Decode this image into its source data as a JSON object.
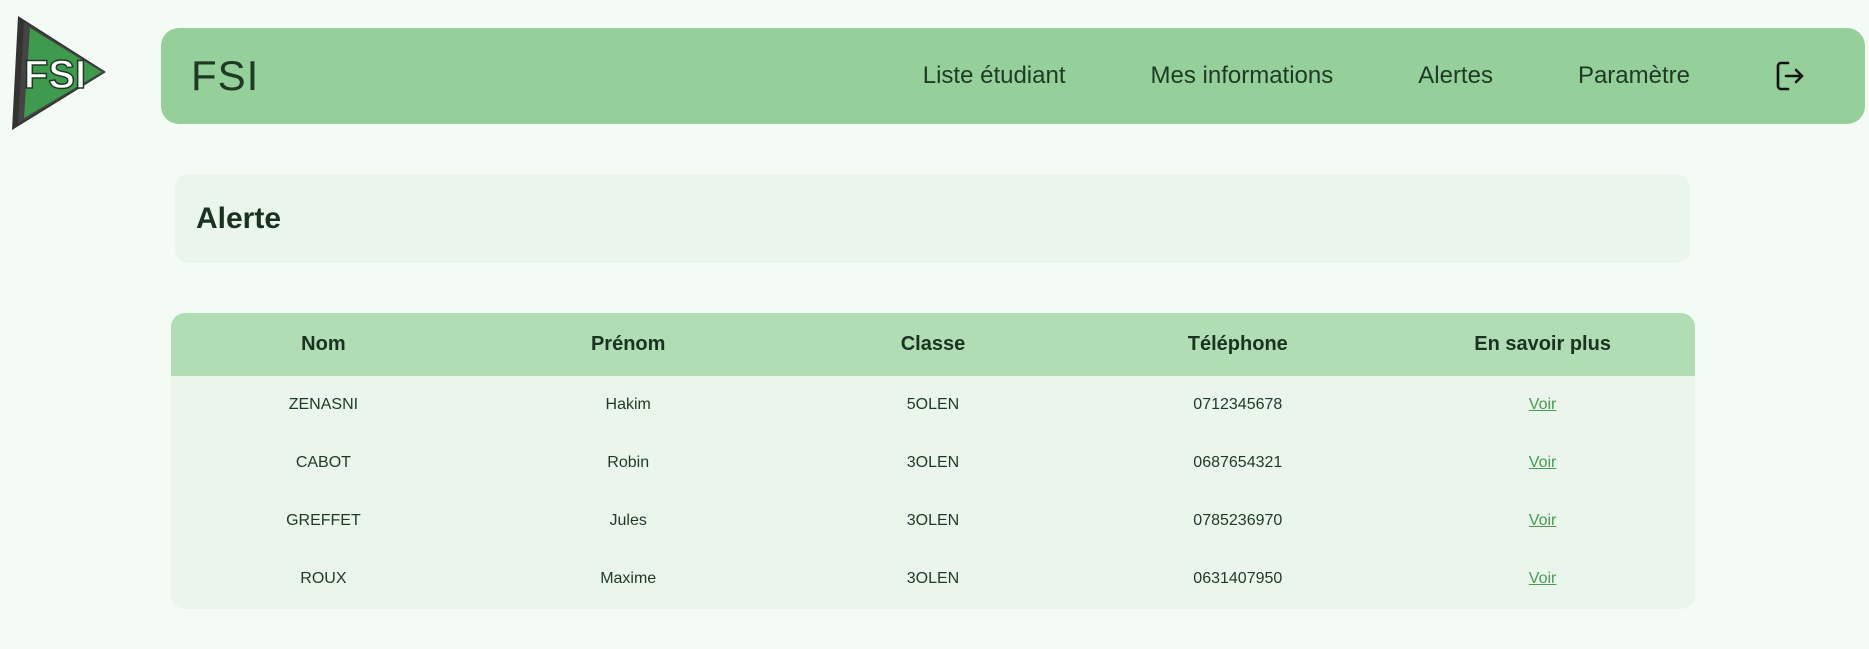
{
  "brand": {
    "logo_text": "FSI",
    "name": "FSI"
  },
  "nav": {
    "items": [
      {
        "label": "Liste étudiant"
      },
      {
        "label": "Mes informations"
      },
      {
        "label": "Alertes"
      },
      {
        "label": "Paramètre"
      }
    ],
    "logout_icon": "logout-icon"
  },
  "page": {
    "title": "Alerte"
  },
  "table": {
    "headers": [
      "Nom",
      "Prénom",
      "Classe",
      "Téléphone",
      "En savoir plus"
    ],
    "rows": [
      {
        "nom": "ZENASNI",
        "prenom": "Hakim",
        "classe": "5OLEN",
        "telephone": "0712345678",
        "link": "Voir"
      },
      {
        "nom": "CABOT",
        "prenom": "Robin",
        "classe": "3OLEN",
        "telephone": "0687654321",
        "link": "Voir"
      },
      {
        "nom": "GREFFET",
        "prenom": "Jules",
        "classe": "3OLEN",
        "telephone": "0785236970",
        "link": "Voir"
      },
      {
        "nom": "ROUX",
        "prenom": "Maxime",
        "classe": "3OLEN",
        "telephone": "0631407950",
        "link": "Voir"
      }
    ]
  },
  "colors": {
    "background": "#f3fbf4",
    "navbar": "#95cf9a",
    "card": "#eaf5eb",
    "table_header": "#b1ddb5",
    "link": "#4a9a55",
    "logo_green": "#3e9a4c",
    "logo_dark": "#333333"
  }
}
